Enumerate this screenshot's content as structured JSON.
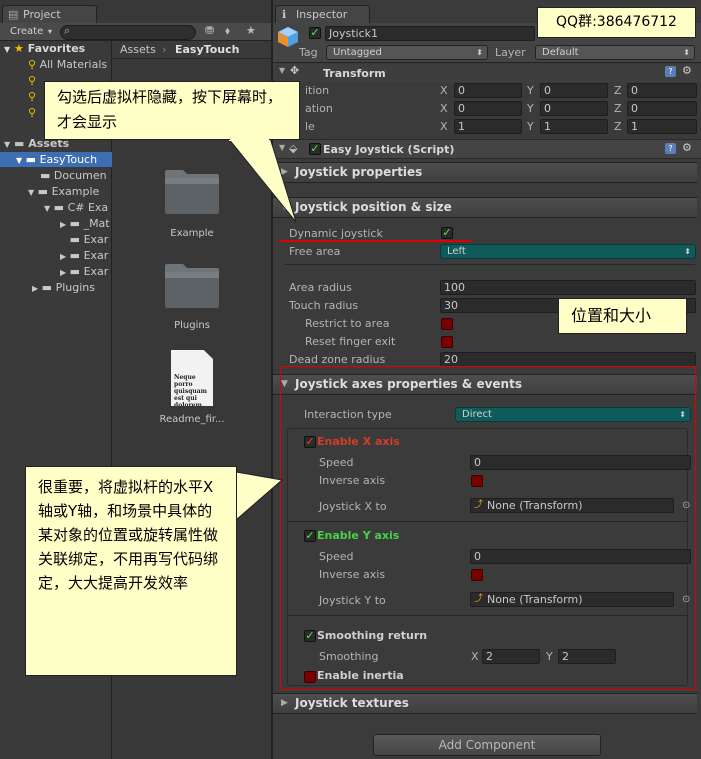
{
  "project": {
    "tab_label": "Project",
    "create_label": "Create",
    "favorites_label": "Favorites",
    "favorites_items": [
      "All Materials"
    ],
    "assets_label": "Assets",
    "breadcrumb": [
      "Assets",
      "EasyTouch"
    ],
    "tree": [
      "Assets",
      "EasyTouch",
      "Documen",
      "Example",
      "C# Exa",
      "_Mat",
      "Exar",
      "Exar",
      "Exar",
      "Plugins"
    ],
    "files": [
      {
        "name": "Example",
        "type": "folder"
      },
      {
        "name": "Plugins",
        "type": "folder"
      },
      {
        "name": "Readme_fir...",
        "type": "doc",
        "doc_text": "Neque porro quisquam est qui dolorem."
      }
    ]
  },
  "inspector": {
    "tab_label": "Inspector",
    "object_name": "Joystick1",
    "tag_label": "Tag",
    "tag_value": "Untagged",
    "layer_label": "Layer",
    "layer_value": "Default",
    "transform": {
      "title": "Transform",
      "rows": [
        {
          "label": "ition",
          "x": "0",
          "y": "0",
          "z": "0"
        },
        {
          "label": "ation",
          "x": "0",
          "y": "0",
          "z": "0"
        },
        {
          "label": "le",
          "x": "1",
          "y": "1",
          "z": "1"
        }
      ]
    },
    "script_title": "Easy Joystick (Script)",
    "sections": {
      "properties": "Joystick properties",
      "position": "Joystick position & size",
      "axes": "Joystick axes properties & events",
      "textures": "Joystick textures"
    },
    "position": {
      "dynamic_label": "Dynamic joystick",
      "free_area_label": "Free area",
      "free_area_value": "Left",
      "area_radius_label": "Area radius",
      "area_radius_value": "100",
      "touch_radius_label": "Touch radius",
      "touch_radius_value": "30",
      "restrict_label": "Restrict to area",
      "reset_label": "Reset  finger exit",
      "dead_zone_label": "Dead zone radius",
      "dead_zone_value": "20"
    },
    "axes": {
      "interaction_label": "Interaction type",
      "interaction_value": "Direct",
      "enable_x": "Enable X axis",
      "speed_label": "Speed",
      "speed_x": "0",
      "inverse_label": "Inverse axis",
      "joystick_x_label": "Joystick X to",
      "joystick_x_value": "None (Transform)",
      "enable_y": "Enable Y axis",
      "speed_y": "0",
      "joystick_y_label": "Joystick Y to",
      "joystick_y_value": "None (Transform)",
      "smoothing_return": "Smoothing return",
      "smoothing_label": "Smoothing",
      "smoothing_x_label": "X",
      "smoothing_x": "2",
      "smoothing_y_label": "Y",
      "smoothing_y": "2",
      "inertia_label": "Enable inertia"
    },
    "add_component": "Add Component"
  },
  "annotations": {
    "qq": "QQ群:386476712",
    "top": "勾选后虚拟杆隐藏，按下屏幕时，才会显示",
    "pos": "位置和大小",
    "bottom": "很重要，将虚拟杆的水平X轴或Y轴，和场景中具体的某对象的位置或旋转属性做关联绑定，不用再写代码绑定，大大提高开发效率"
  },
  "colors": {
    "accent_blue": "#3d6eb4",
    "enable_x": "#d23c28",
    "enable_y": "#46d246",
    "highlight_red": "#e00000",
    "callout": "#ffffc8"
  }
}
